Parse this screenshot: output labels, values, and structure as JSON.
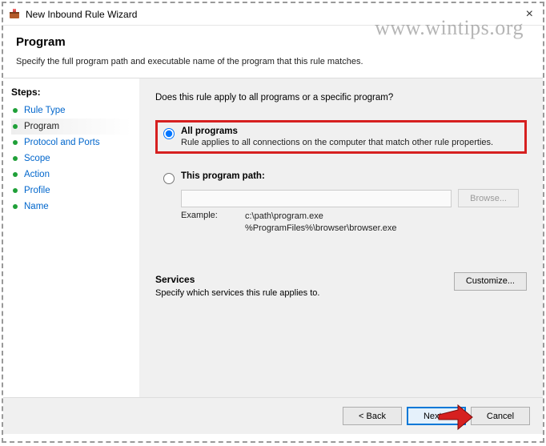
{
  "window": {
    "title": "New Inbound Rule Wizard",
    "close_label": "×"
  },
  "watermark": "www.wintips.org",
  "header": {
    "title": "Program",
    "subtitle": "Specify the full program path and executable name of the program that this rule matches."
  },
  "sidebar": {
    "heading": "Steps:",
    "items": [
      {
        "label": "Rule Type",
        "current": false
      },
      {
        "label": "Program",
        "current": true
      },
      {
        "label": "Protocol and Ports",
        "current": false
      },
      {
        "label": "Scope",
        "current": false
      },
      {
        "label": "Action",
        "current": false
      },
      {
        "label": "Profile",
        "current": false
      },
      {
        "label": "Name",
        "current": false
      }
    ]
  },
  "content": {
    "question": "Does this rule apply to all programs or a specific program?",
    "option_all": {
      "title": "All programs",
      "desc": "Rule applies to all connections on the computer that match other rule properties."
    },
    "option_path": {
      "title": "This program path:",
      "browse": "Browse...",
      "example_label": "Example:",
      "example1": "c:\\path\\program.exe",
      "example2": "%ProgramFiles%\\browser\\browser.exe"
    },
    "services": {
      "title": "Services",
      "desc": "Specify which services this rule applies to.",
      "customize": "Customize..."
    }
  },
  "footer": {
    "back": "< Back",
    "next": "Next >",
    "cancel": "Cancel"
  }
}
